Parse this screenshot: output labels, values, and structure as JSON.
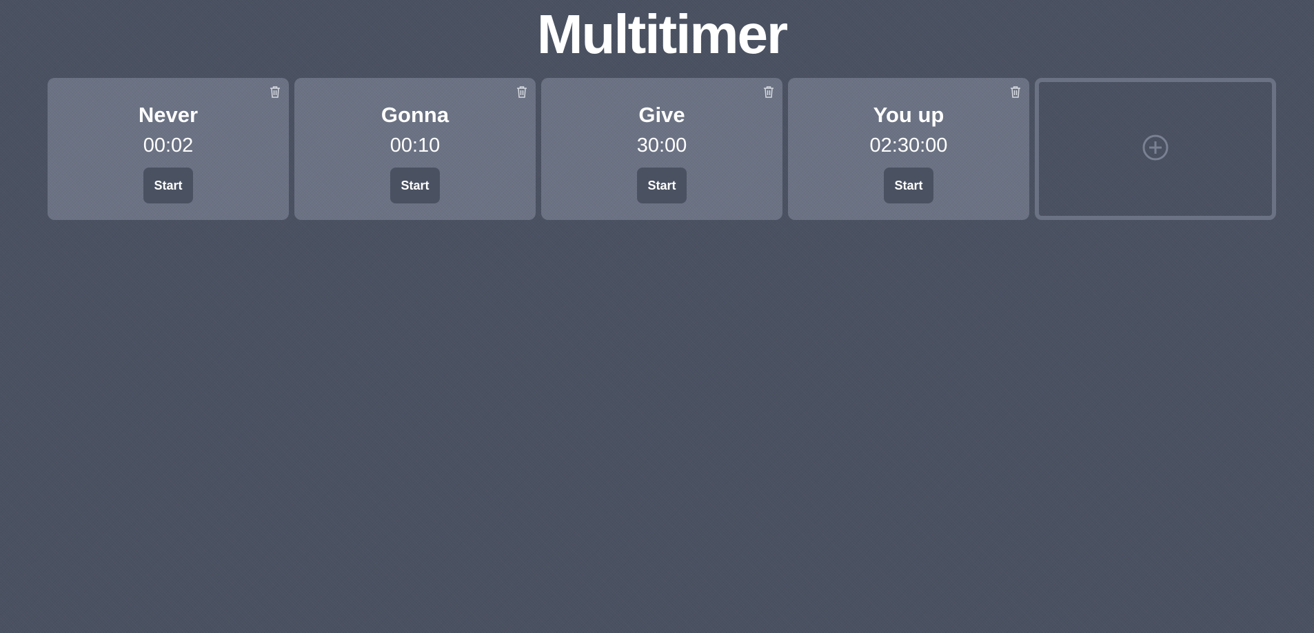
{
  "app": {
    "title": "Multitimer"
  },
  "timers": [
    {
      "name": "Never",
      "time": "00:02",
      "start_label": "Start",
      "delete_icon": "trash-icon"
    },
    {
      "name": "Gonna",
      "time": "00:10",
      "start_label": "Start",
      "delete_icon": "trash-icon"
    },
    {
      "name": "Give",
      "time": "30:00",
      "start_label": "Start",
      "delete_icon": "trash-icon"
    },
    {
      "name": "You up",
      "time": "02:30:00",
      "start_label": "Start",
      "delete_icon": "trash-icon"
    }
  ],
  "add_timer": {
    "icon": "plus-circle-icon"
  },
  "colors": {
    "background": "#4a5161",
    "card": "#6b7283",
    "button": "#4a5161",
    "text": "#ffffff"
  }
}
